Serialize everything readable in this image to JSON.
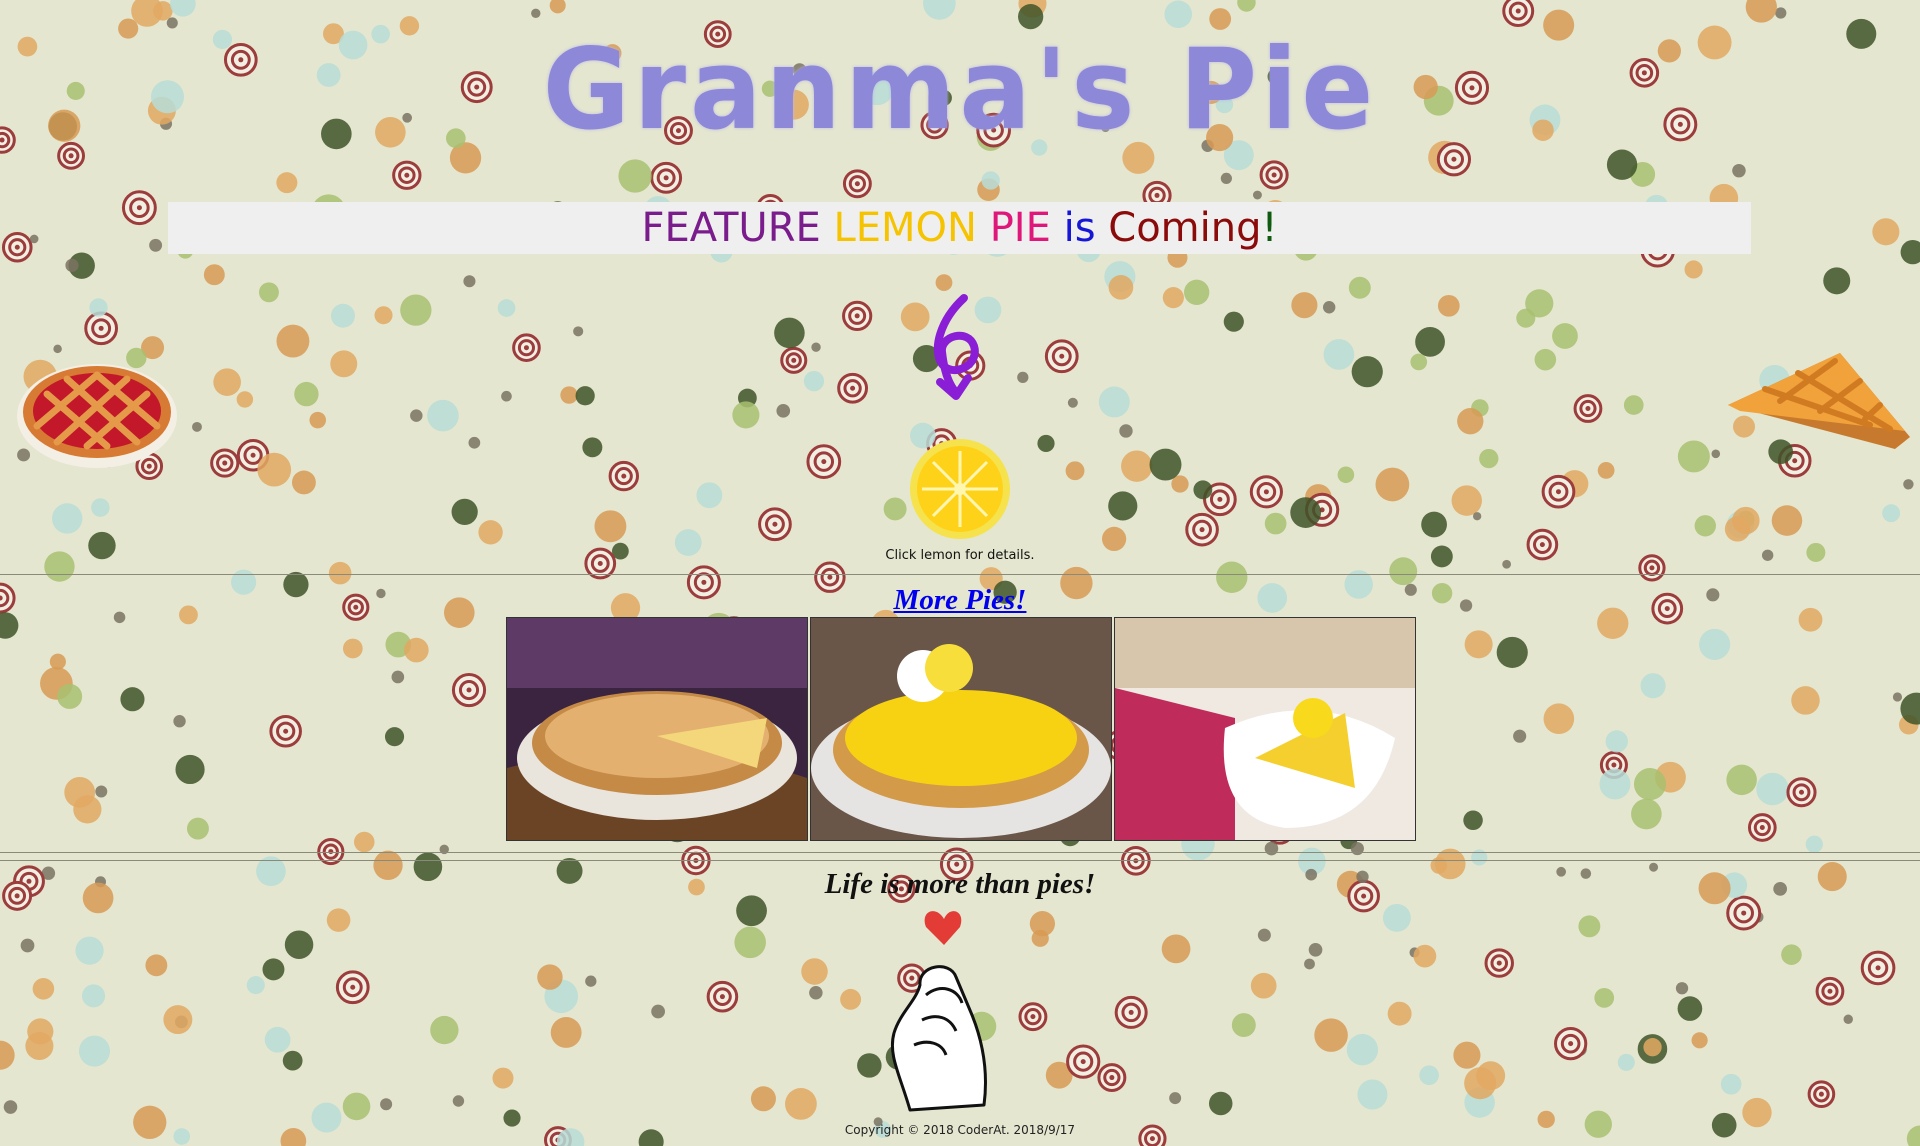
{
  "header": {
    "title": "Granma's Pie"
  },
  "feature": {
    "parts": [
      {
        "text": "FEATURE ",
        "color": "#7a1c8c"
      },
      {
        "text": "LEMON ",
        "color": "#f5c300"
      },
      {
        "text": "PIE ",
        "color": "#e0177a"
      },
      {
        "text": "is ",
        "color": "#1616d6"
      },
      {
        "text": "Coming",
        "color": "#8b0a0a"
      },
      {
        "text": "!",
        "color": "#0e5a0e"
      }
    ]
  },
  "lemon": {
    "caption": "Click lemon for details."
  },
  "more_pies": {
    "link_label": "More Pies!"
  },
  "gallery": [
    {
      "icon": "lemon-meringue-pie-photo"
    },
    {
      "icon": "lemon-tart-photo"
    },
    {
      "icon": "lemon-pie-slice-photo"
    }
  ],
  "footer": {
    "tagline": "Life is more than pies!",
    "copyright": "Copyright © 2018 CoderAt. 2018/9/17"
  },
  "colors": {
    "title": "#8d88d8",
    "banner_bg": "#efefef",
    "link": "#0000ee",
    "arrow": "#8a1ed6"
  }
}
